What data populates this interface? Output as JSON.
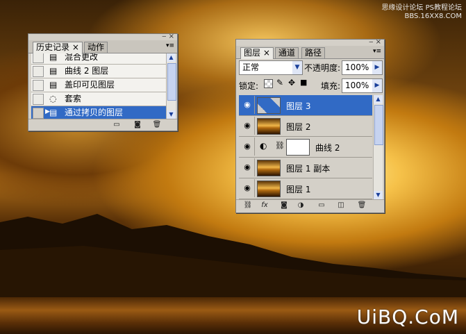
{
  "watermarks": {
    "top_line1": "思缘设计论坛 PS教程论坛",
    "top_line2": "BBS.16XX8.COM",
    "bottom": "UiBQ.CoM"
  },
  "history_panel": {
    "tabs": [
      {
        "label": "历史记录"
      },
      {
        "label": "动作"
      }
    ],
    "close_tab": "×",
    "items": [
      {
        "label": "混合更改",
        "icon": "document-icon"
      },
      {
        "label": "曲线 2 图层",
        "icon": "document-icon"
      },
      {
        "label": "盖印可见图层",
        "icon": "document-icon"
      },
      {
        "label": "套索",
        "icon": "lasso-icon"
      },
      {
        "label": "通过拷贝的图层",
        "icon": "document-icon",
        "selected": true
      }
    ]
  },
  "layers_panel": {
    "tabs": [
      {
        "label": "图层"
      },
      {
        "label": "通道"
      },
      {
        "label": "路径"
      }
    ],
    "blend_mode": "正常",
    "opacity_label": "不透明度:",
    "opacity_value": "100%",
    "lock_label": "锁定:",
    "fill_label": "填充:",
    "fill_value": "100%",
    "layers": [
      {
        "name": "图层 3",
        "selected": true,
        "thumb": "transparent"
      },
      {
        "name": "图层 2",
        "thumb": "sunset"
      },
      {
        "name": "曲线 2",
        "thumb": "white",
        "adjustment": true
      },
      {
        "name": "图层 1 副本",
        "thumb": "sunset"
      },
      {
        "name": "图层 1",
        "thumb": "sunset"
      }
    ]
  },
  "colors": {
    "selection": "#316ac5",
    "panel": "#d4d0c8"
  }
}
